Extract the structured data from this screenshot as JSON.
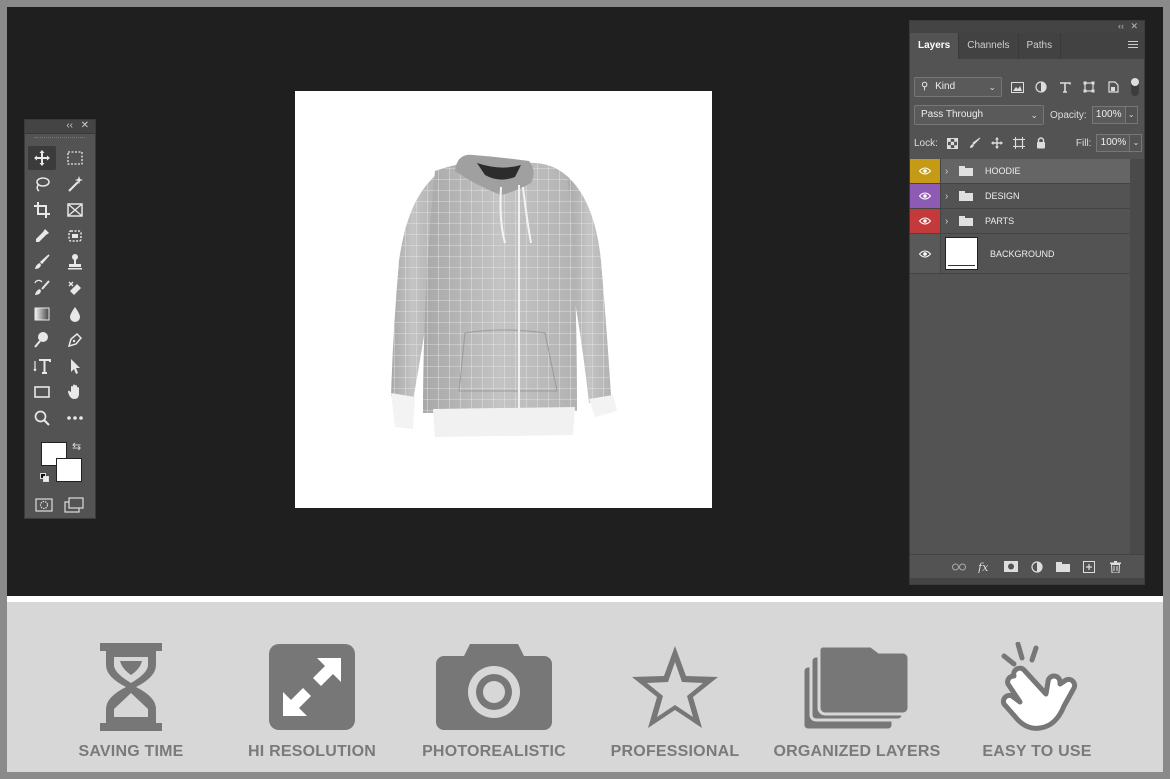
{
  "toolbox": {
    "collapse_glyph": "‹‹",
    "close_glyph": "✕",
    "tools": [
      {
        "name": "move-tool-icon",
        "active": true
      },
      {
        "name": "marquee-tool-icon"
      },
      {
        "name": "lasso-tool-icon"
      },
      {
        "name": "magic-wand-tool-icon"
      },
      {
        "name": "crop-tool-icon"
      },
      {
        "name": "frame-tool-icon"
      },
      {
        "name": "eyedropper-tool-icon"
      },
      {
        "name": "patch-tool-icon"
      },
      {
        "name": "brush-tool-icon"
      },
      {
        "name": "stamp-tool-icon"
      },
      {
        "name": "history-brush-icon"
      },
      {
        "name": "eraser-tool-icon"
      },
      {
        "name": "gradient-tool-icon"
      },
      {
        "name": "blur-tool-icon"
      },
      {
        "name": "dodge-tool-icon"
      },
      {
        "name": "pen-tool-icon"
      },
      {
        "name": "type-tool-icon"
      },
      {
        "name": "path-selection-icon"
      },
      {
        "name": "rectangle-tool-icon"
      },
      {
        "name": "hand-tool-icon"
      },
      {
        "name": "zoom-tool-icon"
      },
      {
        "name": "more-tools-icon"
      }
    ],
    "foreground_color": "#ffffff",
    "background_color": "#ffffff"
  },
  "layers_panel": {
    "collapse_glyph": "‹‹",
    "close_glyph": "✕",
    "tabs": [
      "Layers",
      "Channels",
      "Paths"
    ],
    "active_tab": "Layers",
    "filter_kind": "Kind",
    "blend_mode": "Pass Through",
    "opacity_label": "Opacity:",
    "opacity_value": "100%",
    "lock_label": "Lock:",
    "fill_label": "Fill:",
    "fill_value": "100%",
    "layers": [
      {
        "name": "HOODIE",
        "eye_color": "#c49a16",
        "type": "group",
        "selected": true
      },
      {
        "name": "DESIGN",
        "eye_color": "#8e5bb4",
        "type": "group"
      },
      {
        "name": "PARTS",
        "eye_color": "#c43a3a",
        "type": "group"
      },
      {
        "name": "BACKGROUND",
        "eye_color": "#595959",
        "type": "pixel"
      }
    ]
  },
  "features": [
    {
      "label": "SAVING TIME",
      "icon": "hourglass-icon"
    },
    {
      "label": "HI RESOLUTION",
      "icon": "expand-arrows-icon"
    },
    {
      "label": "PHOTOREALISTIC",
      "icon": "camera-icon"
    },
    {
      "label": "PROFESSIONAL",
      "icon": "star-icon"
    },
    {
      "label": "ORGANIZED LAYERS",
      "icon": "folders-icon"
    },
    {
      "label": "EASY TO USE",
      "icon": "tap-hand-icon"
    }
  ]
}
